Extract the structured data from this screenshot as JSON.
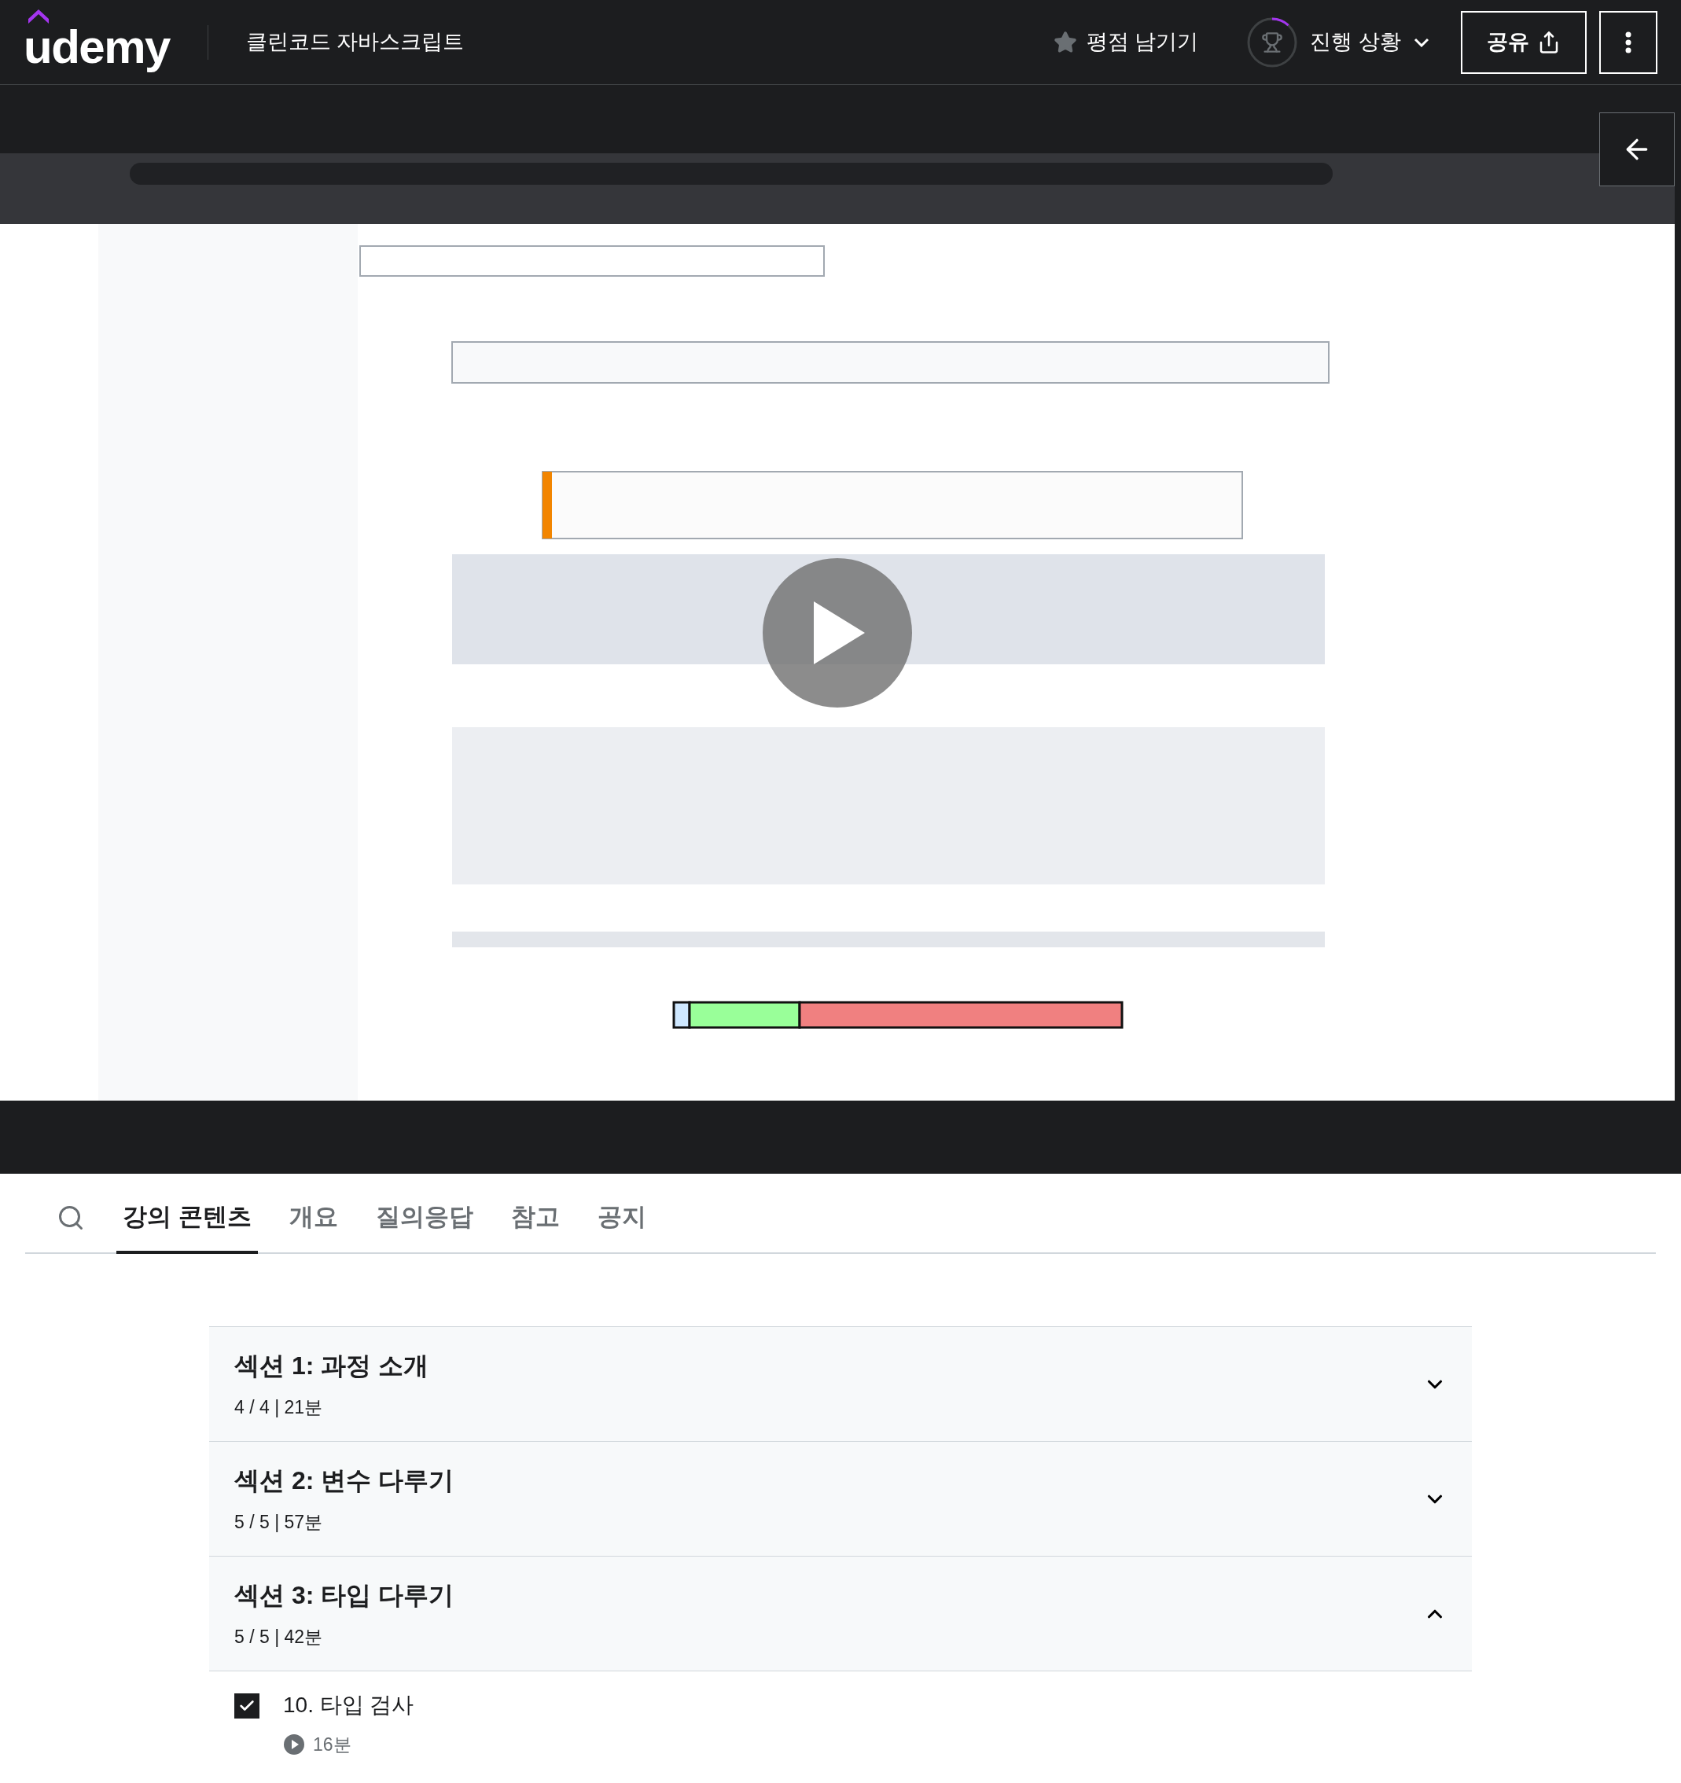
{
  "header": {
    "logo": "udemy",
    "course_title": "클린코드 자바스크립트",
    "rating_button": "평점 남기기",
    "progress": {
      "label": "진행 상황",
      "level": 0.12
    },
    "share_button": "공유"
  },
  "tabs": [
    {
      "label": "강의 콘텐츠",
      "selected": true
    },
    {
      "label": "개요",
      "selected": false
    },
    {
      "label": "질의응답",
      "selected": false
    },
    {
      "label": "참고",
      "selected": false
    },
    {
      "label": "공지",
      "selected": false
    }
  ],
  "sections": [
    {
      "title": "섹션 1: 과정 소개",
      "meta": "4 / 4 | 21분",
      "expanded": false
    },
    {
      "title": "섹션 2: 변수 다루기",
      "meta": "5 / 5 | 57분",
      "expanded": false
    },
    {
      "title": "섹션 3: 타입 다루기",
      "meta": "5 / 5 | 42분",
      "expanded": true,
      "lectures": [
        {
          "title": "10. 타입 검사",
          "checked": true,
          "duration": "16분"
        }
      ]
    }
  ]
}
